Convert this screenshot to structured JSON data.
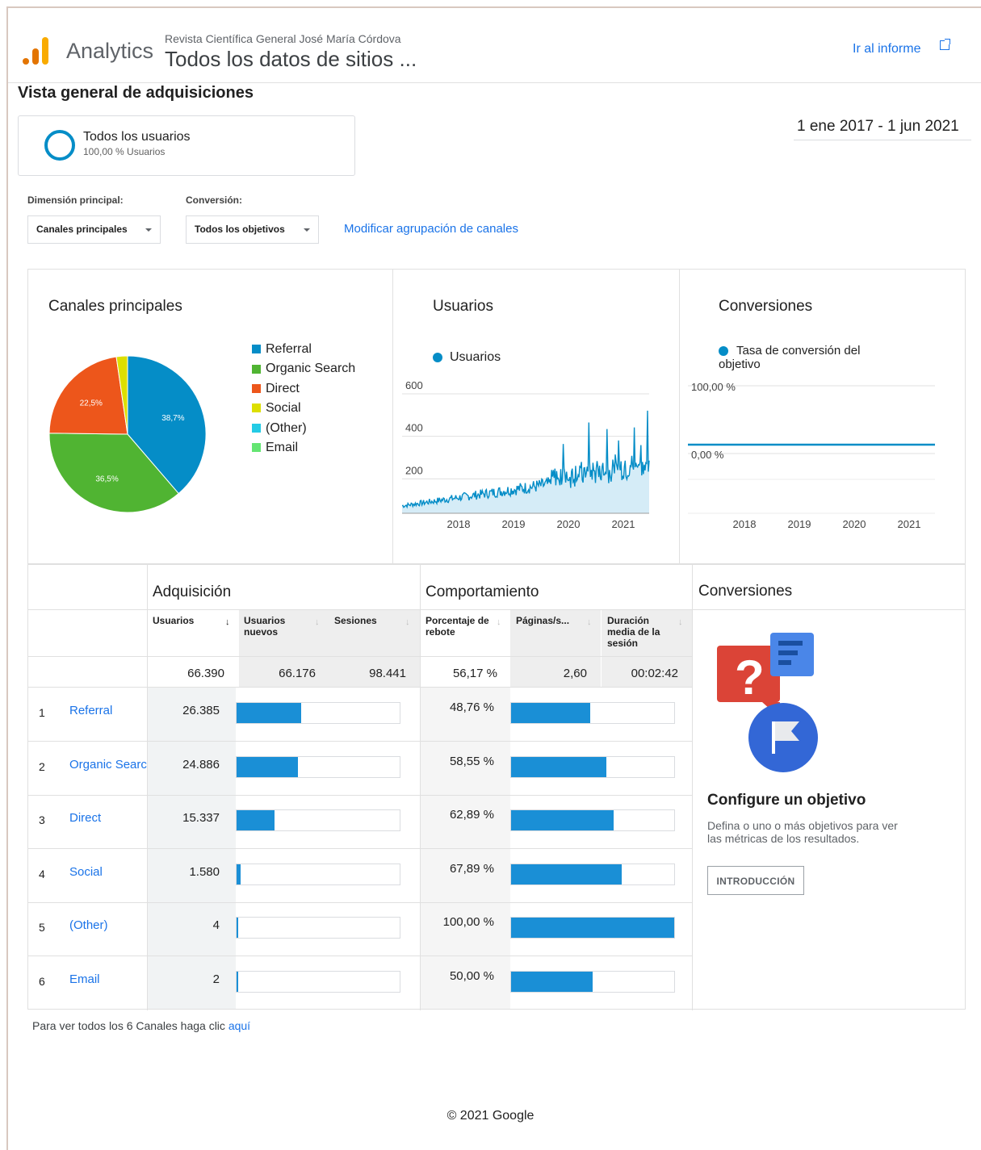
{
  "header": {
    "app_title": "Analytics",
    "property": "Revista Científica General José María Córdova",
    "view": "Todos los datos de sitios ...",
    "go_report": "Ir al informe"
  },
  "page_title": "Vista general de adquisiciones",
  "segment": {
    "name": "Todos los usuarios",
    "percent": "100,00 % Usuarios"
  },
  "date_range": "1 ene 2017 - 1 jun 2021",
  "controls": {
    "dimension_label": "Dimensión principal:",
    "dimension_value": "Canales principales",
    "conversion_label": "Conversión:",
    "conversion_value": "Todos los objetivos",
    "modify_link": "Modificar agrupación de canales"
  },
  "colors": {
    "referral": "#058dc7",
    "organic": "#50b432",
    "direct": "#ed561b",
    "social": "#dddf00",
    "other": "#24cbe5",
    "email": "#64e572",
    "accent": "#1a73e8"
  },
  "chart_data": [
    {
      "type": "pie",
      "title": "Canales principales",
      "categories": [
        "Referral",
        "Organic Search",
        "Direct",
        "Social",
        "(Other)",
        "Email"
      ],
      "values": [
        38.7,
        36.5,
        22.5,
        2.3,
        0.0,
        0.0
      ],
      "slice_labels": [
        "38,7%",
        "36,5%",
        "22,5%"
      ],
      "legend": "right"
    },
    {
      "type": "area",
      "title": "Usuarios",
      "series": [
        {
          "name": "Usuarios"
        }
      ],
      "x_ticks": [
        "2018",
        "2019",
        "2020",
        "2021"
      ],
      "y_ticks": [
        "600",
        "400",
        "200"
      ],
      "ylim": [
        0,
        600
      ]
    },
    {
      "type": "line",
      "title": "Conversiones",
      "series": [
        {
          "name": "Tasa de conversión del objetivo",
          "value": 0
        }
      ],
      "x_ticks": [
        "2018",
        "2019",
        "2020",
        "2021"
      ],
      "y_ticks": [
        "100,00 %",
        "0,00 %"
      ]
    }
  ],
  "table": {
    "group_acq": "Adquisición",
    "group_beh": "Comportamiento",
    "group_conv": "Conversiones",
    "headers": [
      "Usuarios",
      "Usuarios nuevos",
      "Sesiones",
      "Porcentaje de rebote",
      "Páginas/s...",
      "Duración media de la sesión"
    ],
    "totals": [
      "66.390",
      "66.176",
      "98.441",
      "56,17 %",
      "2,60",
      "00:02:42"
    ],
    "rows": [
      {
        "n": "1",
        "name": "Referral",
        "users": "26.385",
        "users_frac": 0.397,
        "bounce": "48,76 %",
        "bounce_frac": 0.4876
      },
      {
        "n": "2",
        "name": "Organic Searc",
        "users": "24.886",
        "users_frac": 0.375,
        "bounce": "58,55 %",
        "bounce_frac": 0.5855
      },
      {
        "n": "3",
        "name": "Direct",
        "users": "15.337",
        "users_frac": 0.231,
        "bounce": "62,89 %",
        "bounce_frac": 0.6289
      },
      {
        "n": "4",
        "name": "Social",
        "users": "1.580",
        "users_frac": 0.024,
        "bounce": "67,89 %",
        "bounce_frac": 0.6789
      },
      {
        "n": "5",
        "name": "(Other)",
        "users": "4",
        "users_frac": 0.0,
        "bounce": "100,00 %",
        "bounce_frac": 1.0
      },
      {
        "n": "6",
        "name": "Email",
        "users": "2",
        "users_frac": 0.0,
        "bounce": "50,00 %",
        "bounce_frac": 0.5
      }
    ]
  },
  "goal": {
    "title": "Configure un objetivo",
    "desc": "Defina o uno o más objetivos para ver las métricas de los resultados.",
    "button": "INTRODUCCIÓN"
  },
  "footer": {
    "note": "Para ver todos los 6 Canales haga clic",
    "link": "aquí",
    "copyright": "© 2021 Google"
  }
}
